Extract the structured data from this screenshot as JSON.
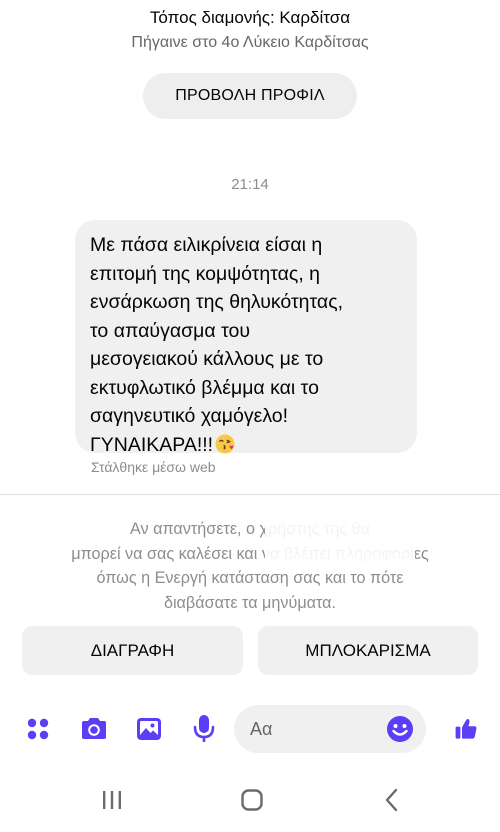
{
  "header": {
    "location_line": "Τόπος διαμονής: Καρδίτσα",
    "school_line": "Πήγαινε στο 4ο Λύκειο Καρδίτσας",
    "view_profile_label": "ΠΡΟΒΟΛΗ ΠΡΟΦΙΛ"
  },
  "conversation": {
    "timestamp": "21:14",
    "message_text": "Με πάσα ειλικρίνεια είσαι η\nεπιτομή της κομψότητας, η\nενσάρκωση της θηλυκότητας,\nτο απαύγασμα του\nμεσογειακού κάλλους με το\nεκτυφλωτικό βλέμμα και το\nσαγηνευτικό χαμόγελο!\nΓΥΝΑΙΚΑΡΑ!!!",
    "message_emoji": "face-blowing-kiss",
    "sent_via": "Στάλθηκε μέσω web"
  },
  "notice": {
    "text": "Αν απαντήσετε, ο χρήστης                                  της θα\nμπορεί να σας καλέσει και να βλέπει πληροφορίες\nόπως η Ενεργή κατάσταση σας και το πότε\nδιαβάσατε τα μηνύματα."
  },
  "actions": {
    "delete_label": "ΔΙΑΓΡΑΦΗ",
    "block_label": "ΜΠΛΟΚΑΡΙΣΜΑ"
  },
  "composer": {
    "placeholder": "Αα",
    "icons": [
      "menu-dots-icon",
      "camera-icon",
      "gallery-icon",
      "microphone-icon",
      "emoji-icon",
      "like-icon"
    ]
  },
  "colors": {
    "accent": "#5b3ff6",
    "bubble": "#f0f0f0",
    "muted_text": "#8a8d91"
  }
}
